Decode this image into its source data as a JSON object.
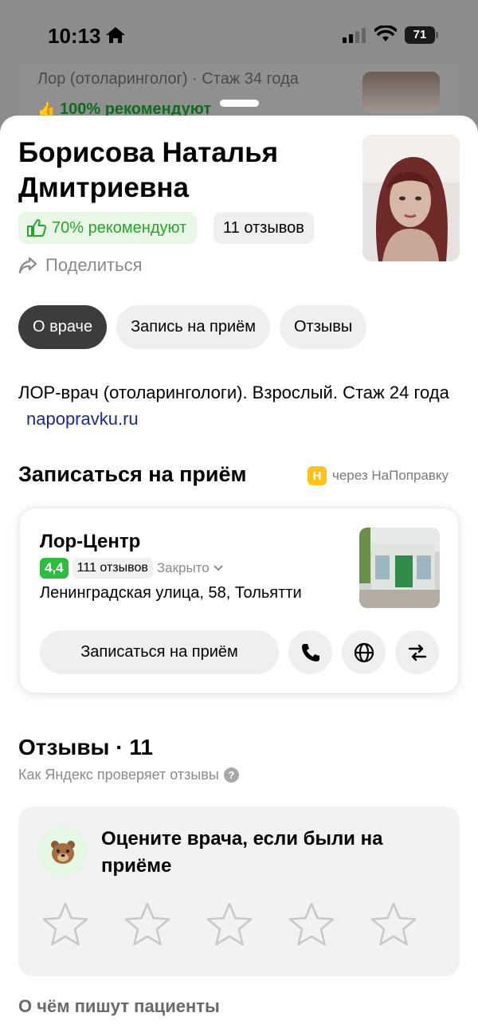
{
  "status_bar": {
    "time": "10:13",
    "battery": "71"
  },
  "background_card": {
    "specialty": "Лор (отоларинголог) · Стаж 34 года",
    "recommend": "100% рекомендуют"
  },
  "doctor": {
    "name": "Борисова Наталья Дмитриевна",
    "recommend": "70% рекомендуют",
    "reviews_count": "11 отзывов",
    "share_label": "Поделиться"
  },
  "tabs": [
    {
      "label": "О враче",
      "active": true
    },
    {
      "label": "Запись на приём",
      "active": false
    },
    {
      "label": "Отзывы",
      "active": false
    }
  ],
  "about": {
    "text": "ЛОР-врач (отоларингологи). Взрослый. Стаж 24 года",
    "link": "napopravku.ru"
  },
  "booking": {
    "title": "Записаться на приём",
    "via_logo": "Н",
    "via_text": "через НаПоправку"
  },
  "clinic": {
    "name": "Лор-Центр",
    "rating": "4,4",
    "reviews": "111 отзывов",
    "status": "Закрыто",
    "address": "Ленинградская улица, 58, Тольятти",
    "book_button": "Записаться на приём"
  },
  "reviews": {
    "title": "Отзывы · 11",
    "verify": "Как Яндекс проверяет отзывы",
    "rate_prompt": "Оцените врача, если были на приёме",
    "stars": 5,
    "topics_title": "О чём пишут пациенты"
  },
  "colors": {
    "accent_green": "#27a52b",
    "rec_bg": "#e8f7e6",
    "tab_active": "#3c3c3c",
    "link": "#1a2c8a",
    "via_logo": "#ffc21a",
    "rating_green": "#2dbb40"
  },
  "icons": [
    "home-icon",
    "signal-icon",
    "wifi-icon",
    "battery-icon",
    "thumbs-up-icon",
    "share-icon",
    "chevron-down-icon",
    "phone-icon",
    "globe-icon",
    "route-icon",
    "question-icon",
    "bear-icon",
    "star-icon"
  ]
}
